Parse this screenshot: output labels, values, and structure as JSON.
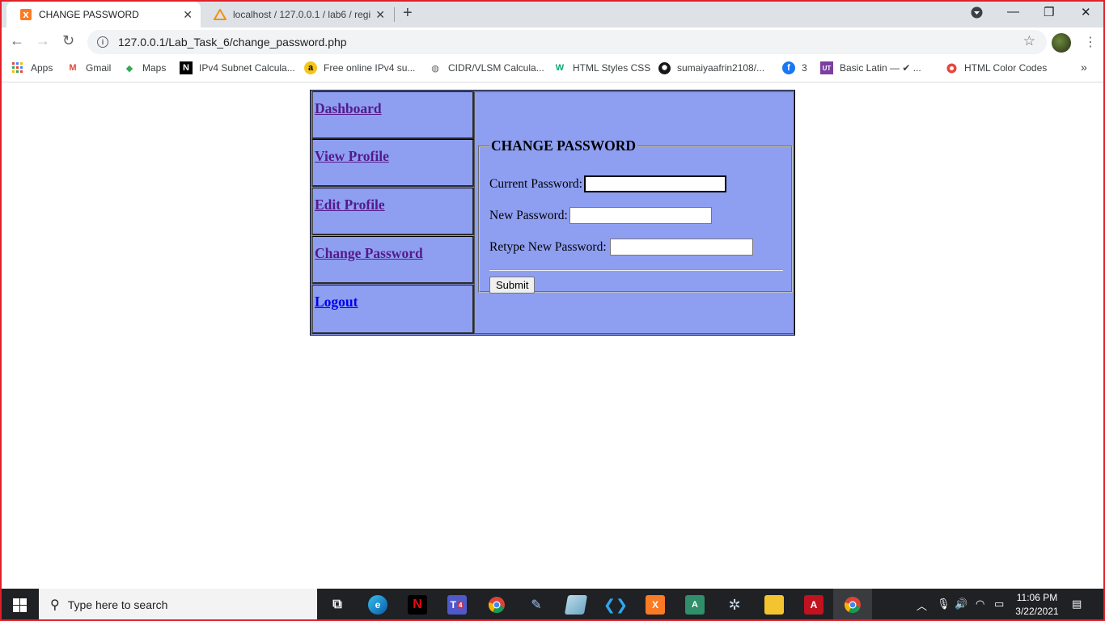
{
  "browser": {
    "tabs": [
      {
        "title": "CHANGE PASSWORD",
        "active": true
      },
      {
        "title": "localhost / 127.0.0.1 / lab6 / regis",
        "active": false
      }
    ],
    "url": "127.0.0.1/Lab_Task_6/change_password.php",
    "bookmarks": [
      {
        "label": "Apps",
        "icon": "apps-grid-icon"
      },
      {
        "label": "Gmail",
        "icon": "gmail-icon"
      },
      {
        "label": "Maps",
        "icon": "maps-icon"
      },
      {
        "label": "IPv4 Subnet Calcula...",
        "icon": "notion-icon"
      },
      {
        "label": "Free online IPv4 su...",
        "icon": "amazon-icon"
      },
      {
        "label": "CIDR/VLSM Calcula...",
        "icon": "globe-icon"
      },
      {
        "label": "HTML Styles CSS",
        "icon": "w3schools-icon"
      },
      {
        "label": "sumaiyaafrin2108/...",
        "icon": "github-icon"
      },
      {
        "label": "3",
        "icon": "facebook-icon"
      },
      {
        "label": "Basic Latin — ✔ ...",
        "icon": "ut-icon"
      },
      {
        "label": "HTML Color Codes",
        "icon": "color-icon"
      }
    ]
  },
  "page": {
    "nav": [
      {
        "label": "Dashboard",
        "visited": true
      },
      {
        "label": "View Profile",
        "visited": true
      },
      {
        "label": "Edit Profile",
        "visited": true
      },
      {
        "label": "Change Password",
        "visited": true
      },
      {
        "label": "Logout",
        "visited": false
      }
    ],
    "form": {
      "legend": "CHANGE PASSWORD",
      "fields": [
        {
          "label": "Current Password:",
          "value": ""
        },
        {
          "label": "New Password:",
          "value": ""
        },
        {
          "label": "Retype New Password:",
          "value": ""
        }
      ],
      "submit_label": "Submit"
    },
    "colors": {
      "panel_bg": "#8e9ff2",
      "visited_link": "#551a8b",
      "link": "#0000ee"
    }
  },
  "taskbar": {
    "search_placeholder": "Type here to search",
    "teams_badge": "4",
    "clock_time": "11:06 PM",
    "clock_date": "3/22/2021"
  }
}
